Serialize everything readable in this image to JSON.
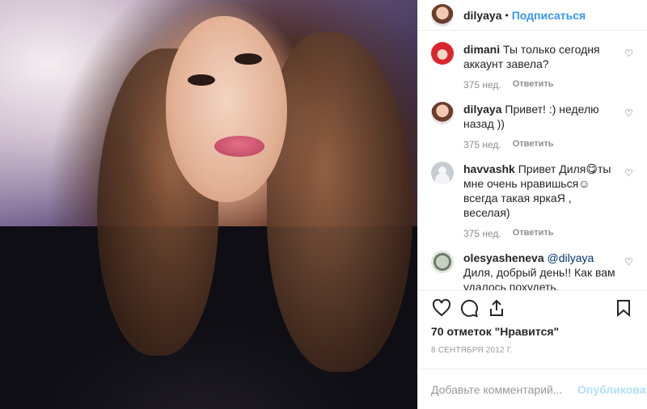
{
  "header": {
    "username": "dilyaya",
    "separator": "•",
    "follow_label": "Подписаться"
  },
  "comments": [
    {
      "username": "dimani",
      "text": "Ты только сегодня аккаунт завела?",
      "age": "375 нед.",
      "reply_label": "Ответить",
      "heart_icon": "heart-outline-icon"
    },
    {
      "username": "dilyaya",
      "text": "Привет! :) неделю назад ))",
      "age": "375 нед.",
      "reply_label": "Ответить",
      "heart_icon": "heart-outline-icon"
    },
    {
      "username": "havvashk",
      "text": "Привет Диля😋ты мне очень нравишься☺ всегда такая яркаЯ , веселая)",
      "age": "375 нед.",
      "reply_label": "Ответить",
      "heart_icon": "heart-outline-icon"
    },
    {
      "username": "olesyasheneva",
      "mention": "@dilyaya",
      "text": "Диля, добрый день!! Как вам удалось похудеть, поделитесь пожалуйста секретом.❤",
      "heart_icon": "heart-outline-icon"
    }
  ],
  "actions": {
    "icons": [
      "heart-icon",
      "comment-icon",
      "share-icon",
      "bookmark-icon"
    ]
  },
  "likes_text": "70 отметок \"Нравится\"",
  "date_text": "8 СЕНТЯБРЯ 2012 Г.",
  "add_comment": {
    "placeholder": "Добавьте комментарий...",
    "publish_label": "Опубликовать"
  },
  "colors": {
    "accent": "#3897f0",
    "publish_disabled": "#b2dffc",
    "muted": "#8e8e8e"
  }
}
